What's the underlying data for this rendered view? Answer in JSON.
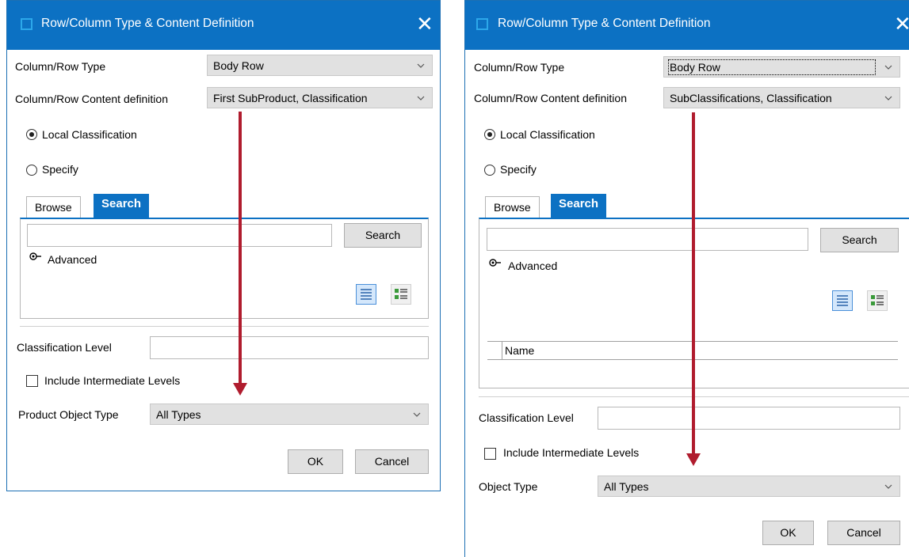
{
  "dialogs": [
    {
      "title": "Row/Column Type & Content Definition",
      "close_glyph": "✕",
      "type_label": "Column/Row Type",
      "type_value": "Body Row",
      "content_label": "Column/Row Content definition",
      "content_value": "First SubProduct, Classification",
      "radio_local": "Local Classification",
      "radio_specify": "Specify",
      "tab_browse": "Browse",
      "tab_search": "Search",
      "search_button": "Search",
      "advanced": "Advanced",
      "classification_level_label": "Classification Level",
      "include_intermediate": "Include Intermediate Levels",
      "object_type_label": "Product Object Type",
      "object_type_value": "All Types",
      "ok": "OK",
      "cancel": "Cancel"
    },
    {
      "title": "Row/Column Type & Content Definition",
      "close_glyph": "✕",
      "type_label": "Column/Row Type",
      "type_value": "Body Row",
      "content_label": "Column/Row Content definition",
      "content_value": "SubClassifications, Classification",
      "radio_local": "Local Classification",
      "radio_specify": "Specify",
      "tab_browse": "Browse",
      "tab_search": "Search",
      "search_button": "Search",
      "advanced": "Advanced",
      "list_column_name": "Name",
      "classification_level_label": "Classification Level",
      "include_intermediate": "Include Intermediate Levels",
      "object_type_label": "Object Type",
      "object_type_value": "All Types",
      "ok": "OK",
      "cancel": "Cancel"
    }
  ],
  "icons": {
    "chevron": "chevron-down-icon",
    "advanced": "advanced-toggle-icon",
    "list_view": "list-view-icon",
    "detail_view": "detail-view-icon",
    "window": "window-icon"
  },
  "colors": {
    "titlebar": "#0c71c3",
    "annotation_arrow": "#b01c2e"
  }
}
